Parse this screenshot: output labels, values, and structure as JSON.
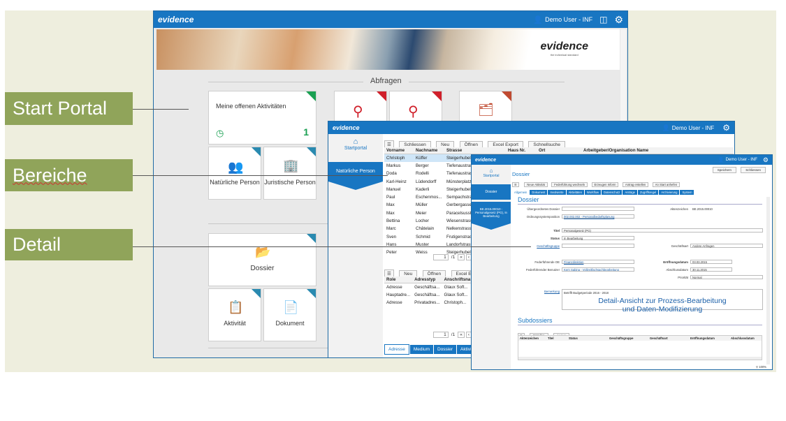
{
  "callouts": {
    "start": "Start Portal",
    "bereiche": "Bereiche",
    "detail": "Detail"
  },
  "win1": {
    "logo": "evidence",
    "user": "Demo User - INF",
    "banner_logo": "evidence",
    "banner_tagline": "the individual standard",
    "section_title": "Abfragen",
    "activities_tile": {
      "label": "Meine offenen Aktivitäten",
      "count": "1"
    },
    "tile_natural": "Natürliche Person",
    "tile_legal": "Juristische Person",
    "tile_dossier": "Dossier",
    "tile_activity": "Aktivität",
    "tile_document": "Dokument"
  },
  "win2": {
    "logo": "evidence",
    "user": "Demo User - INF",
    "nav_start": "Startportal",
    "nav_natural": "Natürliche Person",
    "toolbar": [
      "Schliessen",
      "Neu",
      "Öffnen",
      "Excel Export",
      "Schnellsuche"
    ],
    "columns": [
      "Vorname",
      "Nachname",
      "Strasse",
      "Haus Nr.",
      "Ort",
      "Arbeitgeber/Organisation Name"
    ],
    "rows": [
      [
        "Christoph",
        "Küffer",
        "Steigerhubelst"
      ],
      [
        "Markus",
        "Berger",
        "Tiefenaustrass"
      ],
      [
        "Doda",
        "Rodelli",
        "Tiefenaustrass"
      ],
      [
        "Karl-Heinz",
        "Lüdendorff",
        "Münsterplatz"
      ],
      [
        "Manuel",
        "Kaderli",
        "Steigerhubels"
      ],
      [
        "Paul",
        "Eschenmos...",
        "Sempachstras"
      ],
      [
        "Max",
        "Müller",
        "Gerbergasse"
      ],
      [
        "Max",
        "Meier",
        "Paracelsusstr"
      ],
      [
        "Bettina",
        "Locher",
        "Wiesenstrasse"
      ],
      [
        "Marc",
        "Châtelain",
        "Nelkenstrasse"
      ],
      [
        "Sven",
        "Schmid",
        "Frutigenstrass"
      ],
      [
        "Hans",
        "Muster",
        "Landorfstrass"
      ],
      [
        "Peter",
        "Weiss",
        "Steigerhubels"
      ]
    ],
    "pager1_page": "1",
    "pager1_total": "/1",
    "toolbar2": [
      "Neu",
      "Öffnen",
      "Excel Exp"
    ],
    "columns2": [
      "Role",
      "Adresstyp",
      "Anschriftsna"
    ],
    "rows2": [
      [
        "Adresse",
        "Geschäftsa...",
        "Glaux Soft..."
      ],
      [
        "Hauptadre...",
        "Geschäftsa...",
        "Glaux Soft..."
      ],
      [
        "Adresse",
        "Privatadres...",
        "Christoph..."
      ]
    ],
    "pager2_page": "1",
    "pager2_total": "/1",
    "bottom_tabs": [
      "Adresse",
      "Medium",
      "Dossier",
      "Aktivität"
    ]
  },
  "win3": {
    "logo": "evidence",
    "user": "Demo User - INF",
    "nav_start": "Startportal",
    "nav_dossier": "Dossier",
    "nav_case": "BE.2015.00010 - Personalgesetz (PG), In Bearbeitung",
    "header_title": "Dossier",
    "save": "Speichern",
    "close": "Schliessen",
    "actions": [
      "Neue Aktivität",
      "Federführung wechseln",
      "Erzeugen Inform",
      "Antrag erstellen",
      "An Start anhefen"
    ],
    "tabs": [
      "Allgemein",
      "Dokument",
      "Involvierte",
      "Aktivitäten",
      "Workflow",
      "Datenschutz",
      "Anträge",
      "Zugriffsregel",
      "Archivierung",
      "System"
    ],
    "section": "Dossier",
    "fields": {
      "parent_label": "Übergeordnetes Dossier",
      "ordnung_label": "Ordnungssystemposition",
      "ordnung_value": "002.002.002 - Personalbedarfsplanung",
      "aktenzeichen_label": "Aktenzeichen",
      "aktenzeichen_value": "BE.2015.00010",
      "titel_label": "Titel",
      "titel_value": "Personalgesetz (PG)",
      "status_label": "Status",
      "status_value": "In Bearbeitung",
      "gruppe_label": "Geschäftsgruppe",
      "art_label": "Geschäftsart",
      "art_value": "Andere Anfragen",
      "oe_label": "Federführende OE",
      "oe_value": "Finanzdirektion",
      "eroeffnung_label": "Eröffnungsdatum",
      "eroeffnung_value": "03.03.2015",
      "benutzer_label": "Federführender Benutzer",
      "benutzer_value": "Kern Sabina - Vollzeitfachsachbearbeitung",
      "abschluss_label": "Abschlussdatum",
      "abschluss_value": "30.11.2015",
      "prio_label": "Priorität",
      "prio_value": "Normal",
      "bemerkung_label": "Bemerkung",
      "bemerkung_value": "Betrifft Budgetperiode 2016 - 2018"
    },
    "overlay_line1": "Detail-Ansicht zur Prozess-Bearbeitung",
    "overlay_line2": "und Daten-Modifizierung",
    "subdossiers_title": "Subdossiers",
    "sub_toolbar": [
      "Erstellen",
      "Ändern"
    ],
    "sub_columns": [
      "Aktenzeichen",
      "Titel",
      "Status",
      "Geschäftsgruppe",
      "Geschäftsart",
      "Eröffnungsdatum",
      "Abschlussdatum"
    ],
    "zoom": "100%"
  },
  "colors": {
    "blue": "#1876c2",
    "callout": "#90a45a",
    "accent_green": "#1aa052",
    "accent_red": "#d0202a",
    "accent_teal": "#2a8ab0"
  }
}
